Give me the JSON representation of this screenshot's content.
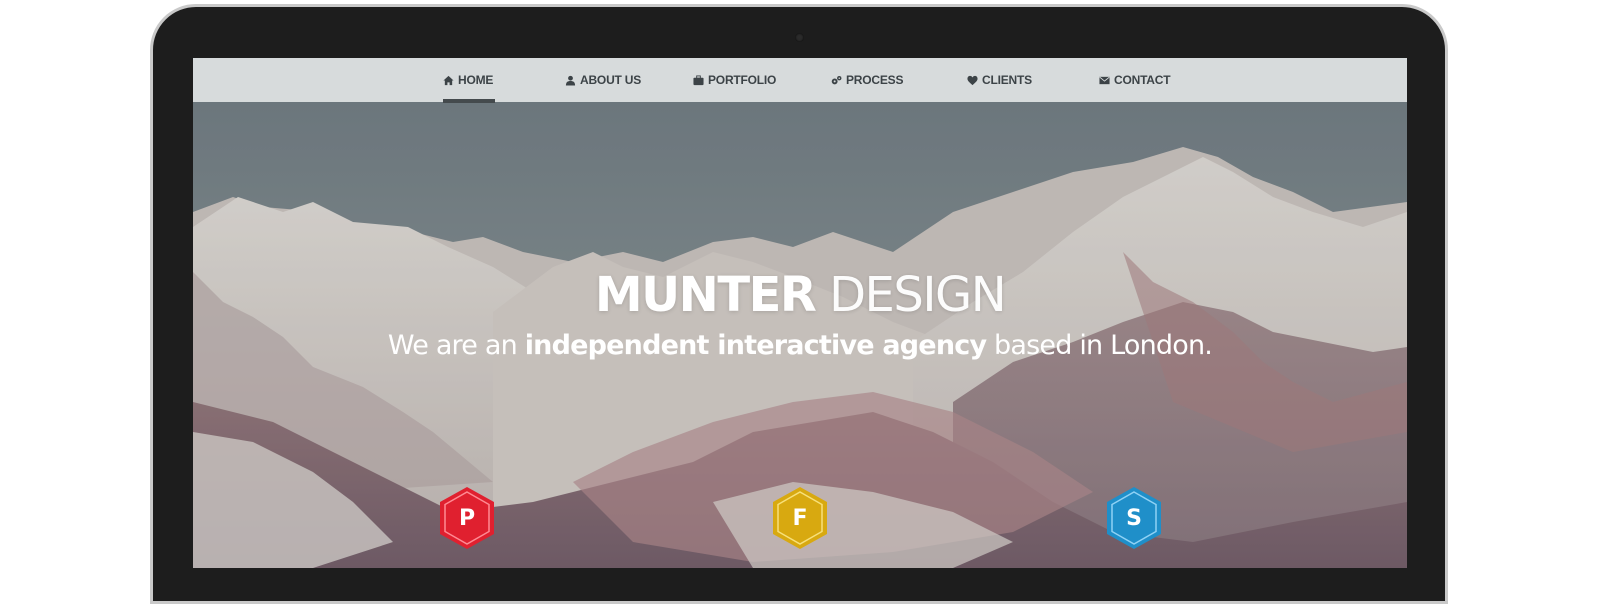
{
  "nav": {
    "items": [
      {
        "label": "HOME",
        "icon": "home-icon"
      },
      {
        "label": "ABOUT US",
        "icon": "user-icon"
      },
      {
        "label": "PORTFOLIO",
        "icon": "briefcase-icon"
      },
      {
        "label": "PROCESS",
        "icon": "gears-icon"
      },
      {
        "label": "CLIENTS",
        "icon": "heart-icon"
      },
      {
        "label": "CONTACT",
        "icon": "envelope-icon"
      }
    ],
    "active": "HOME"
  },
  "hero": {
    "title_strong": "MUNTER",
    "title_light": "DESIGN",
    "sub_pre": "We are an ",
    "sub_bold": "independent interactive agency",
    "sub_post": " based in London."
  },
  "badges": [
    {
      "letter": "P",
      "color": "#e0202f"
    },
    {
      "letter": "F",
      "color": "#d8a910"
    },
    {
      "letter": "S",
      "color": "#1f8fc9"
    }
  ]
}
